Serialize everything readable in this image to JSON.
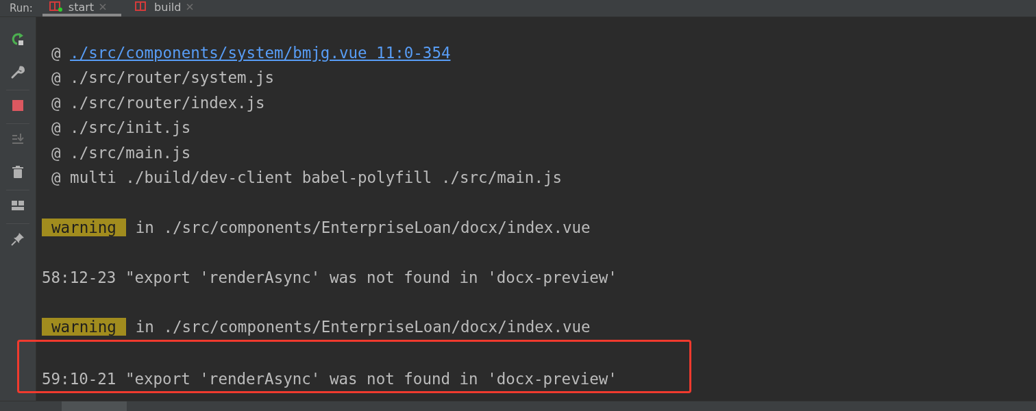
{
  "run_bar": {
    "label": "Run:",
    "tabs": [
      {
        "label": "start",
        "selected": true,
        "running": true
      },
      {
        "label": "build",
        "selected": false,
        "running": false
      }
    ]
  },
  "console": {
    "lines": [
      {
        "kind": "link",
        "text": "./src/components/system/bmjg.vue 11:0-354",
        "prefix": "@"
      },
      {
        "kind": "trace",
        "text": "@ ./src/router/system.js"
      },
      {
        "kind": "trace",
        "text": "@ ./src/router/index.js"
      },
      {
        "kind": "trace",
        "text": "@ ./src/init.js"
      },
      {
        "kind": "trace",
        "text": "@ ./src/main.js"
      },
      {
        "kind": "trace",
        "text": "@ multi ./build/dev-client babel-polyfill ./src/main.js"
      },
      {
        "kind": "blank"
      },
      {
        "kind": "warning",
        "badge": "warning",
        "text": "in ./src/components/EnterpriseLoan/docx/index.vue"
      },
      {
        "kind": "blank"
      },
      {
        "kind": "plain",
        "text": "58:12-23 \"export 'renderAsync' was not found in 'docx-preview'"
      },
      {
        "kind": "blank"
      },
      {
        "kind": "warning",
        "badge": "warning",
        "text": "in ./src/components/EnterpriseLoan/docx/index.vue"
      },
      {
        "kind": "blank",
        "highlighted": true
      },
      {
        "kind": "plain",
        "text": "59:10-21 \"export 'renderAsync' was not found in 'docx-preview'",
        "highlighted": true
      }
    ]
  }
}
